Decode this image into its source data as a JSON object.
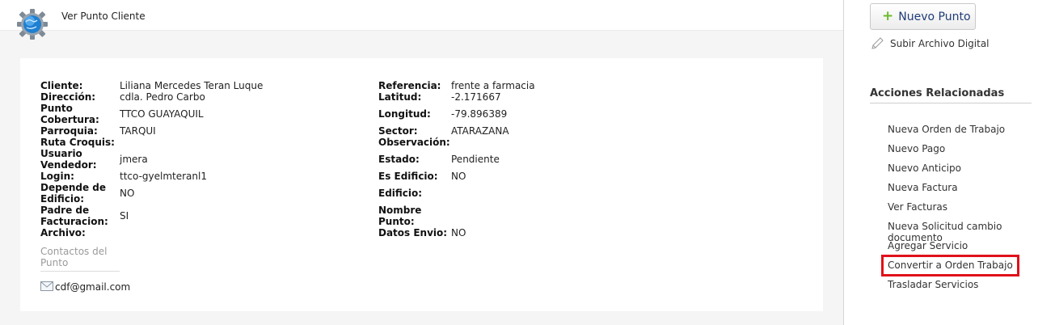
{
  "header": {
    "title": "Ver Punto Cliente",
    "icon": "gear-globe-icon"
  },
  "details": {
    "left": [
      {
        "label": "Cliente:",
        "value": "Liliana Mercedes Teran Luque"
      },
      {
        "label": "Dirección:",
        "value": "cdla. Pedro Carbo"
      },
      {
        "label": "Punto Cobertura:",
        "value": "TTCO GUAYAQUIL"
      },
      {
        "label": "Parroquia:",
        "value": "TARQUI"
      },
      {
        "label": "Ruta Croquis:",
        "value": ""
      },
      {
        "label": "Usuario Vendedor:",
        "value": "jmera"
      },
      {
        "label": "Login:",
        "value": "ttco-gyelmteranl1"
      },
      {
        "label": "Depende de Edificio:",
        "value": "NO"
      },
      {
        "label": "Padre de Facturacion:",
        "value": "SI"
      },
      {
        "label": "Archivo:",
        "value": ""
      }
    ],
    "right": [
      {
        "label": "Referencia:",
        "value": "frente a farmacia"
      },
      {
        "label": "Latitud:",
        "value": "-2.171667"
      },
      {
        "label": "Longitud:",
        "value": "-79.896389"
      },
      {
        "label": "Sector:",
        "value": "ATARAZANA"
      },
      {
        "label": "Observación:",
        "value": ""
      },
      {
        "label": "Estado:",
        "value": "Pendiente"
      },
      {
        "label": "Es Edificio:",
        "value": "NO"
      },
      {
        "label": "Edificio:",
        "value": ""
      },
      {
        "label": "Nombre Punto:",
        "value": ""
      },
      {
        "label": "Datos Envio:",
        "value": "NO"
      }
    ]
  },
  "contacts": {
    "title": "Contactos del Punto",
    "email_icon": "envelope-icon",
    "email": "cdf@gmail.com"
  },
  "sidebar": {
    "new_point_label": "Nuevo Punto",
    "upload_label": "Subir Archivo Digital",
    "related_title": "Acciones Relacionadas",
    "actions": [
      "Nueva Orden de Trabajo",
      "Nuevo Pago",
      "Nuevo Anticipo",
      "Nueva Factura",
      "Ver Facturas",
      "Nueva Solicitud cambio documento",
      "Agregar Servicio",
      "Convertir a Orden Trabajo",
      "Trasladar Servicios"
    ],
    "highlight_color": "#e0101a",
    "accent_color": "#1f3c78"
  }
}
